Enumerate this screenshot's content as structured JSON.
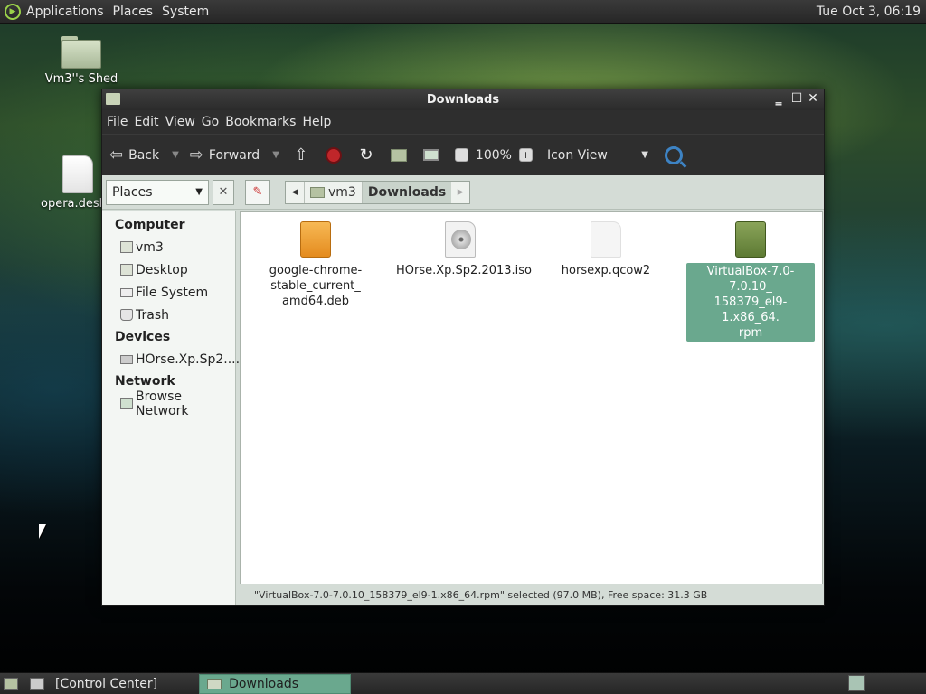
{
  "top_panel": {
    "menus": [
      "Applications",
      "Places",
      "System"
    ],
    "clock": "Tue Oct  3, 06:19"
  },
  "desktop": {
    "icons": [
      {
        "label": "Vm3''s Shed",
        "kind": "home-folder"
      },
      {
        "label": "opera.desk",
        "kind": "file"
      }
    ]
  },
  "window": {
    "title": "Downloads",
    "menubar": [
      "File",
      "Edit",
      "View",
      "Go",
      "Bookmarks",
      "Help"
    ],
    "toolbar": {
      "back": "Back",
      "forward": "Forward",
      "zoom": "100%",
      "view_mode": "Icon View"
    },
    "location": {
      "places_label": "Places",
      "crumbs": [
        "vm3",
        "Downloads"
      ]
    },
    "sidebar": {
      "sections": [
        {
          "title": "Computer",
          "items": [
            "vm3",
            "Desktop",
            "File System",
            "Trash"
          ]
        },
        {
          "title": "Devices",
          "items": [
            "HOrse.Xp.Sp2...."
          ]
        },
        {
          "title": "Network",
          "items": [
            "Browse Network"
          ]
        }
      ]
    },
    "files": [
      {
        "name": "google-chrome-stable_current_amd64.deb",
        "lines": [
          "google-chrome-",
          "stable_current_",
          "amd64.deb"
        ],
        "type": "deb",
        "selected": false
      },
      {
        "name": "HOrse.Xp.Sp2.2013.iso",
        "lines": [
          "HOrse.Xp.Sp2.2013.iso"
        ],
        "type": "iso",
        "selected": false
      },
      {
        "name": "horsexp.qcow2",
        "lines": [
          "horsexp.qcow2"
        ],
        "type": "qcow2",
        "selected": false
      },
      {
        "name": "VirtualBox-7.0-7.0.10_158379_el9-1.x86_64.rpm",
        "lines": [
          "VirtualBox-7.0-7.0.10_",
          "158379_el9-1.x86_64.",
          "rpm"
        ],
        "type": "rpm",
        "selected": true
      }
    ],
    "status": "\"VirtualBox-7.0-7.0.10_158379_el9-1.x86_64.rpm\" selected (97.0 MB), Free space: 31.3 GB"
  },
  "bottom_panel": {
    "tasks": [
      {
        "label": "[Control Center]",
        "active": false
      },
      {
        "label": "Downloads",
        "active": true
      }
    ]
  }
}
